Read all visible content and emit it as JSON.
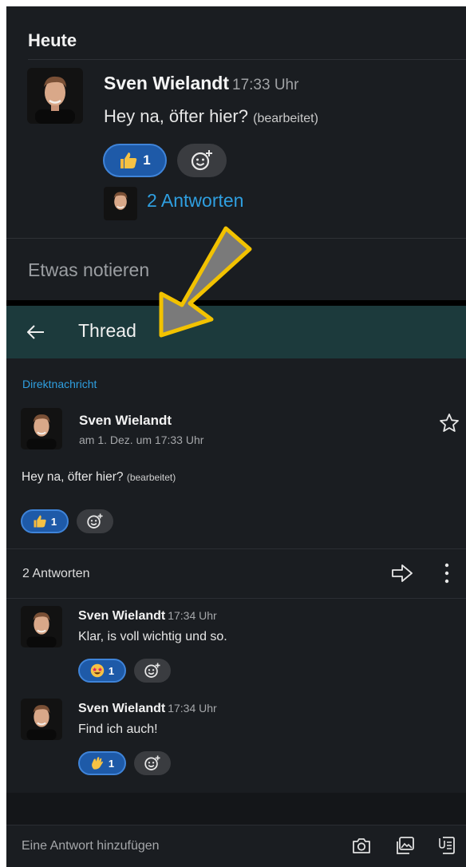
{
  "top": {
    "section_title": "Heute",
    "message": {
      "author": "Sven Wielandt",
      "time": "17:33 Uhr",
      "text": "Hey na, öfter hier?",
      "edited": "(bearbeitet)",
      "reaction": {
        "icon": "thumbs-up-icon",
        "count": "1"
      }
    },
    "replies_link": "2 Antworten",
    "note_placeholder": "Etwas notieren"
  },
  "thread": {
    "title": "Thread",
    "context_label": "Direktnachricht",
    "parent": {
      "author": "Sven Wielandt",
      "date": "am 1. Dez. um 17:33 Uhr",
      "text": "Hey na, öfter hier?",
      "edited": "(bearbeitet)",
      "reaction": {
        "icon": "thumbs-up-icon",
        "count": "1"
      }
    },
    "replies_count_label": "2 Antworten",
    "replies": [
      {
        "author": "Sven Wielandt",
        "time": "17:34 Uhr",
        "text": "Klar, is voll wichtig und so.",
        "reaction": {
          "icon": "star-struck-icon",
          "count": "1"
        }
      },
      {
        "author": "Sven Wielandt",
        "time": "17:34 Uhr",
        "text": "Find ich auch!",
        "reaction": {
          "icon": "clap-icon",
          "count": "1"
        }
      }
    ],
    "composer_placeholder": "Eine Antwort hinzufügen"
  },
  "colors": {
    "background": "#1a1d21",
    "header": "#1c3a3c",
    "link": "#2f9fe0",
    "reaction_active": "#1e5aa8",
    "annotation_arrow": "#f2c200"
  }
}
